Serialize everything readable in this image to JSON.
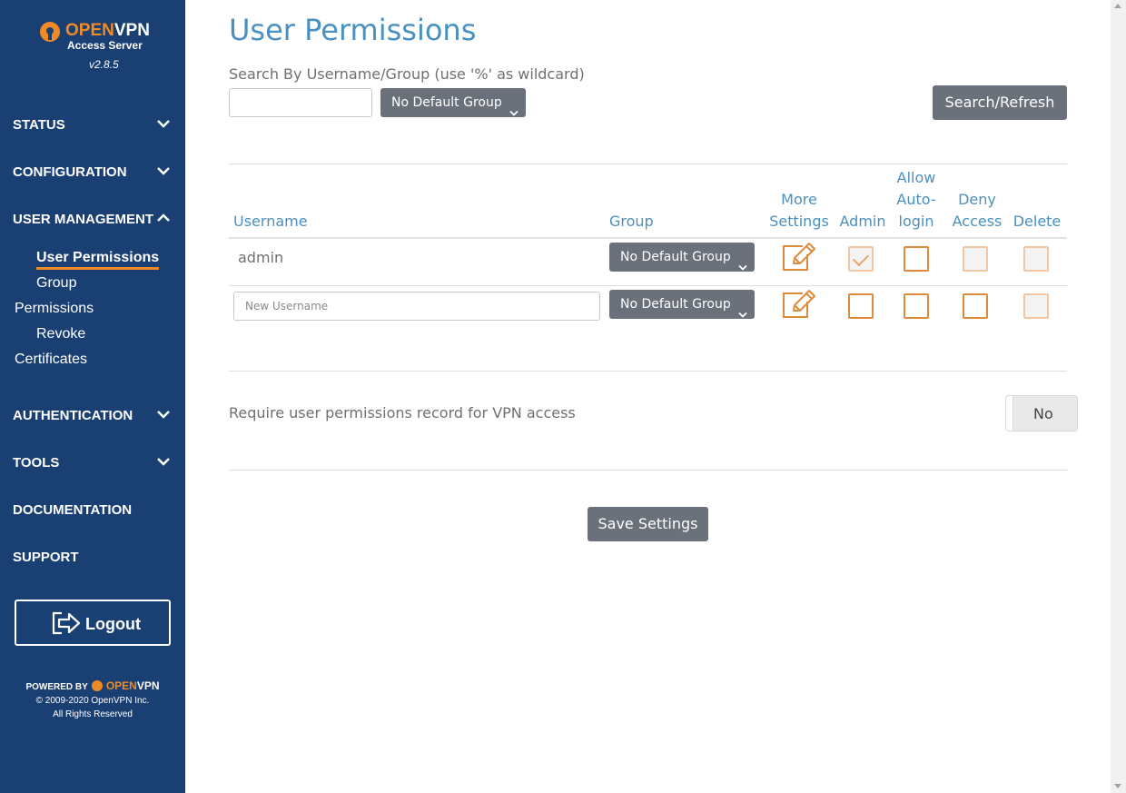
{
  "brand": {
    "open": "OPEN",
    "vpn": "VPN",
    "subtitle": "Access Server",
    "version": "v2.8.5"
  },
  "nav": {
    "status": "STATUS",
    "configuration": "CONFIGURATION",
    "user_management": "USER  MANAGEMENT",
    "authentication": "AUTHENTICATION",
    "tools": "TOOLS",
    "documentation": "DOCUMENTATION",
    "support": "SUPPORT",
    "sub": {
      "user_permissions": "User Permissions",
      "group": "Group",
      "permissions": "Permissions",
      "revoke": "Revoke",
      "certificates": "Certificates"
    }
  },
  "logout": {
    "label": "Logout"
  },
  "footer": {
    "powered_by": "POWERED BY",
    "open": "OPEN",
    "vpn": "VPN",
    "copyright": "© 2009-2020 OpenVPN Inc.",
    "rights": "All Rights Reserved"
  },
  "page": {
    "title": "User Permissions",
    "search_label": "Search By Username/Group (use '%' as wildcard)",
    "search_value": "",
    "group_filter": "No Default Group",
    "search_button": "Search/Refresh"
  },
  "table": {
    "headers": {
      "username": "Username",
      "group": "Group",
      "more_settings_1": "More",
      "more_settings_2": "Settings",
      "admin": "Admin",
      "allow_1": "Allow",
      "allow_2": "Auto-",
      "allow_3": "login",
      "deny_1": "Deny",
      "deny_2": "Access",
      "delete": "Delete"
    },
    "rows": [
      {
        "username": "admin",
        "group": "No Default Group"
      }
    ],
    "new_row": {
      "placeholder": "New Username",
      "group": "No Default Group"
    }
  },
  "require": {
    "label": "Require user permissions record for VPN access",
    "toggle": "No"
  },
  "save_button": "Save Settings",
  "colors": {
    "sidebar": "#1a3f72",
    "accent": "#f08a24",
    "heading": "#4a90c0",
    "button": "#6b717a"
  }
}
